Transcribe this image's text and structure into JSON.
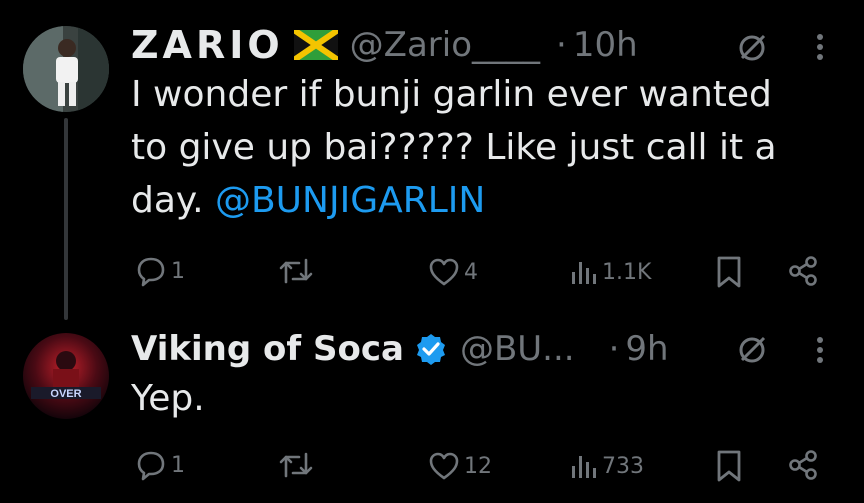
{
  "tweets": [
    {
      "display_name": "ZARIO",
      "flag_emoji": "jamaica-flag",
      "handle": "@Zario____",
      "separator": "·",
      "time": "10h",
      "text_lines": [
        "I wonder if bunji garlin ever wanted",
        "to give up bai????? Like just call it a"
      ],
      "text_last_prefix": "day. ",
      "mention": "@BUNJIGARLIN",
      "actions": {
        "replies": "1",
        "retweets": "",
        "likes": "4",
        "views": "1.1K"
      }
    },
    {
      "display_name": "Viking of Soca",
      "verified": true,
      "handle": "@BU...",
      "separator": "·",
      "time": "9h",
      "text": "Yep.",
      "avatar_text": "OVER",
      "actions": {
        "replies": "1",
        "retweets": "",
        "likes": "12",
        "views": "733"
      }
    }
  ],
  "colors": {
    "background": "#000000",
    "text": "#e7e9ea",
    "muted": "#71767b",
    "mention": "#1d9bf0",
    "verified": "#1d9bf0"
  },
  "icons": [
    "reply-icon",
    "retweet-icon",
    "like-icon",
    "views-icon",
    "bookmark-icon",
    "share-icon",
    "grok-icon",
    "more-icon",
    "verified-badge-icon"
  ]
}
